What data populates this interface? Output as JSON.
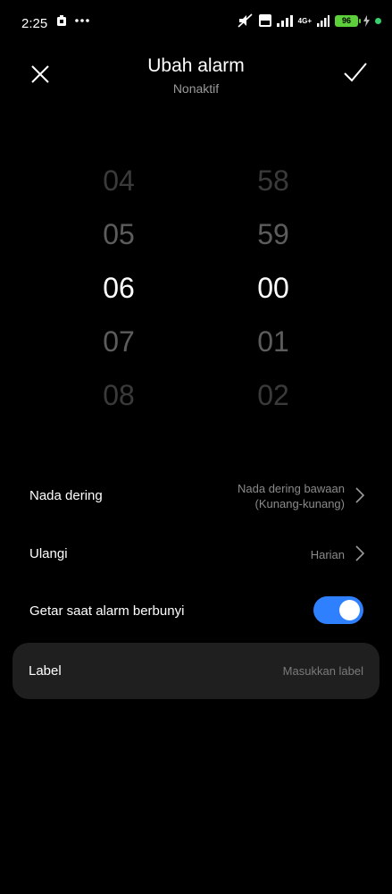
{
  "status": {
    "time": "2:25",
    "network": "4G+",
    "battery": "96",
    "icons": [
      "notification-icon",
      "more-dots-icon",
      "mute-icon",
      "volte-icon",
      "signal-icon",
      "signal-4g-icon",
      "battery-icon",
      "charging-icon",
      "dot-green-icon"
    ]
  },
  "header": {
    "title": "Ubah alarm",
    "subtitle": "Nonaktif"
  },
  "picker": {
    "hours": [
      "04",
      "05",
      "06",
      "07",
      "08"
    ],
    "minutes": [
      "58",
      "59",
      "00",
      "01",
      "02"
    ],
    "selected_hour": "06",
    "selected_minute": "00"
  },
  "settings": {
    "ringtone": {
      "label": "Nada dering",
      "value_line1": "Nada dering bawaan",
      "value_line2": "(Kunang-kunang)"
    },
    "repeat": {
      "label": "Ulangi",
      "value": "Harian"
    },
    "vibrate": {
      "label": "Getar saat alarm berbunyi",
      "enabled": true
    },
    "label": {
      "label": "Label",
      "placeholder": "Masukkan label"
    }
  },
  "colors": {
    "accent": "#2f80ff",
    "background": "#000000",
    "card": "#1f1f1f",
    "battery": "#5ccf3a"
  }
}
